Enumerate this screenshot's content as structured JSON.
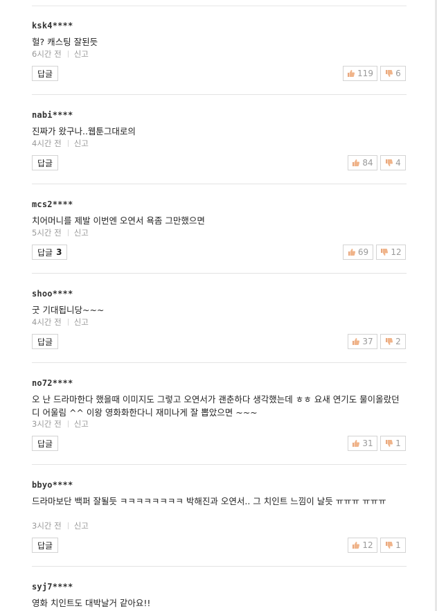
{
  "labels": {
    "report": "신고",
    "reply": "답글"
  },
  "comments": [
    {
      "username": "ksk4****",
      "text": "헐? 캐스팅 잘된듯",
      "time": "6시간 전",
      "reply_count": "",
      "likes": "119",
      "dislikes": "6"
    },
    {
      "username": "nabi****",
      "text": "진짜가 왔구나..웹툰그대로의",
      "time": "4시간 전",
      "reply_count": "",
      "likes": "84",
      "dislikes": "4"
    },
    {
      "username": "mcs2****",
      "text": "치어머니를 제발 이번엔 오연서 욕좀 그만했으면",
      "time": "5시간 전",
      "reply_count": "3",
      "likes": "69",
      "dislikes": "12"
    },
    {
      "username": "shoo****",
      "text": "굿 기대됩니당~~~",
      "time": "4시간 전",
      "reply_count": "",
      "likes": "37",
      "dislikes": "2"
    },
    {
      "username": "no72****",
      "text": "오 난 드라마한다 했을때 이미지도 그렇고 오연서가 괜춘하다 생각했는데 ㅎㅎ 요새 연기도 물이올랐던디 어울림 ^^ 이왕 영화화한다니 재미나게 잘 뽑았으면 ~~~",
      "time": "3시간 전",
      "reply_count": "",
      "likes": "31",
      "dislikes": "1"
    },
    {
      "username": "bbyo****",
      "text": "드라마보단 백퍼 잘될듯 ㅋㅋㅋㅋㅋㅋㅋㅋ 박해진과 오연서.. 그 치인트 느낌이 날듯 ㅠㅠㅠ ㅠㅠㅠ",
      "time": "3시간 전",
      "reply_count": "",
      "likes": "12",
      "dislikes": "1"
    },
    {
      "username": "syj7****",
      "text": "영화 치인트도 대박날거 같아요!!"
    }
  ]
}
